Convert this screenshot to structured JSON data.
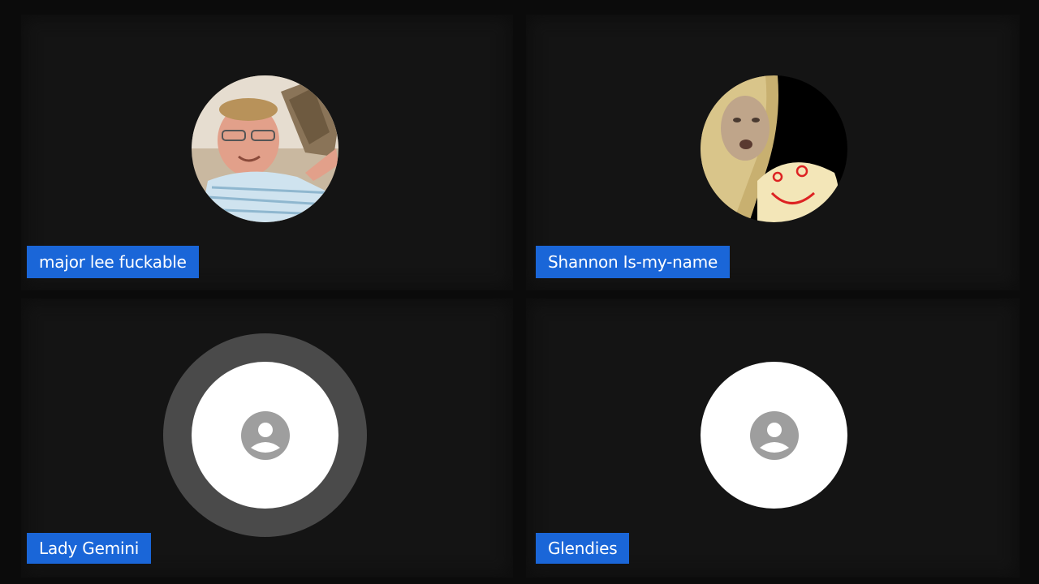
{
  "participants": [
    {
      "name": "major lee fuckable",
      "avatar": "photo-man-icon",
      "speaking": false
    },
    {
      "name": "Shannon Is-my-name",
      "avatar": "photo-woman-icon",
      "speaking": false
    },
    {
      "name": "Lady Gemini",
      "avatar": "default-person-icon",
      "speaking": true
    },
    {
      "name": "Glendies",
      "avatar": "default-person-icon",
      "speaking": false
    }
  ],
  "colors": {
    "label_background": "#1a66d8",
    "tile_background": "#141414",
    "page_background": "#0b0b0b",
    "speaking_ring": "#4a4a4a",
    "placeholder_icon": "#9e9e9e"
  }
}
